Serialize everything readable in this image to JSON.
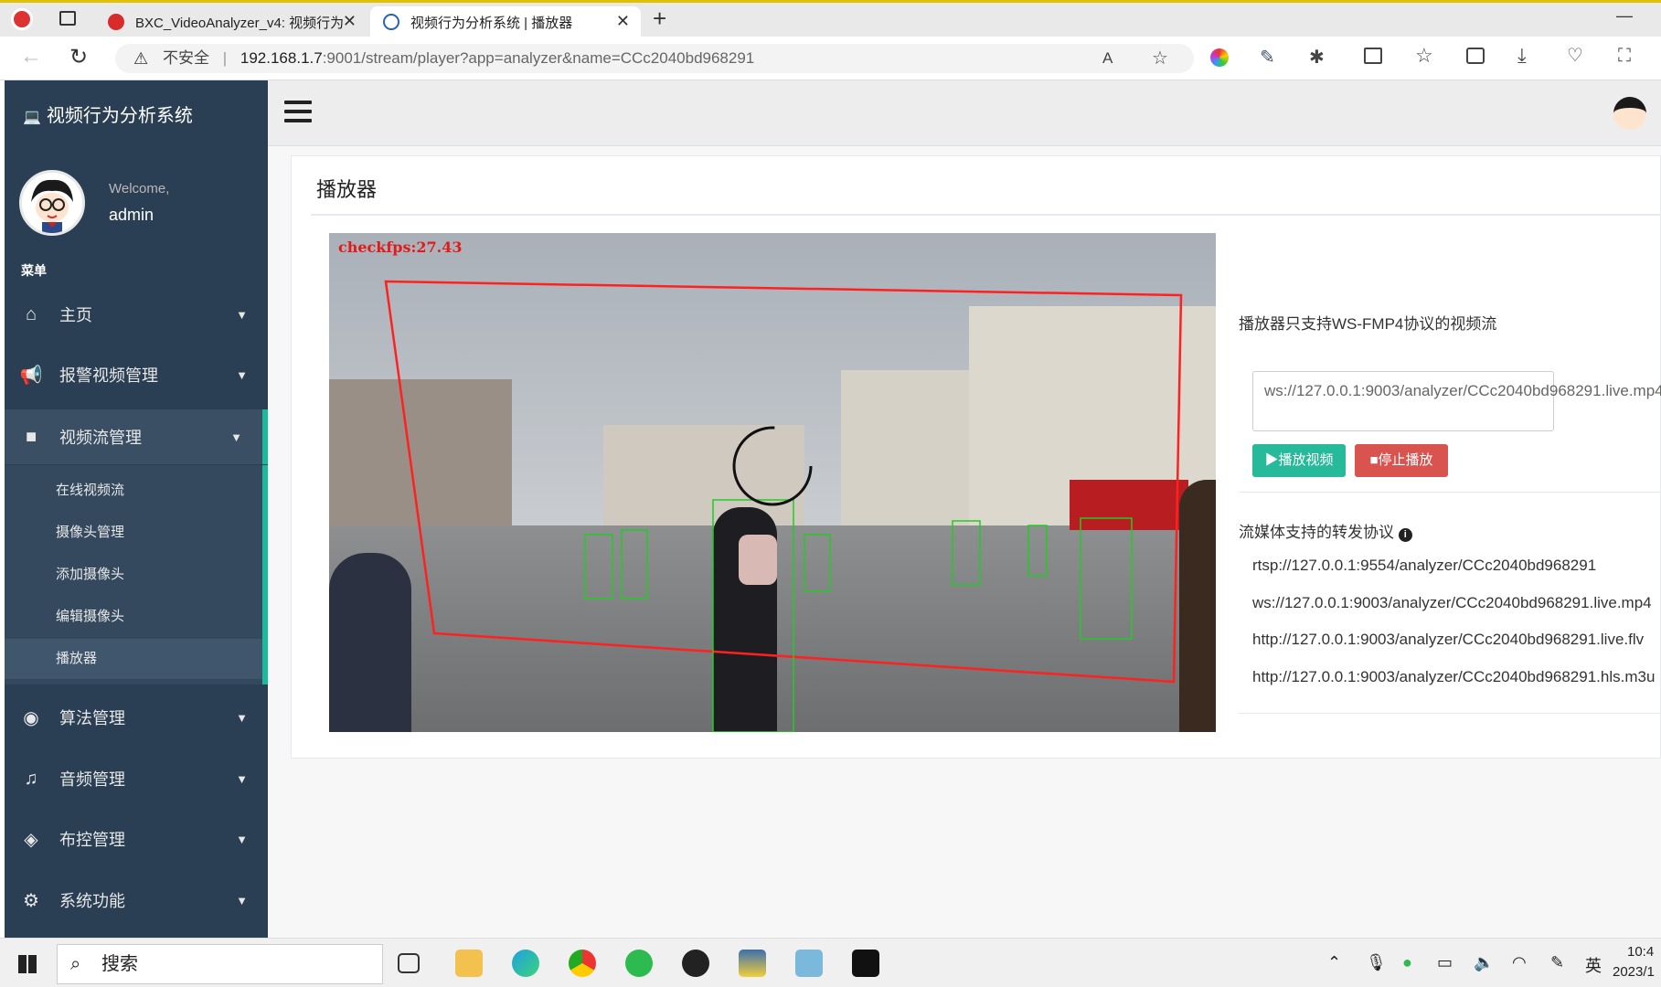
{
  "browser": {
    "tabs": [
      {
        "label": "BXC_VideoAnalyzer_v4: 视频行为",
        "active": false
      },
      {
        "label": "视频行为分析系统 | 播放器",
        "active": true
      }
    ],
    "security": "不安全",
    "url_host": "192.168.1.7",
    "url_rest": ":9001/stream/player?app=analyzer&name=CCc2040bd968291"
  },
  "sidebar": {
    "brand": "视频行为分析系统",
    "welcome": "Welcome,",
    "username": "admin",
    "menu_heading": "菜单",
    "items": [
      {
        "label": "主页",
        "icon": "home-icon"
      },
      {
        "label": "报警视频管理",
        "icon": "bullhorn-icon"
      },
      {
        "label": "视频流管理",
        "icon": "video-camera-icon"
      },
      {
        "label": "算法管理",
        "icon": "eye-icon"
      },
      {
        "label": "音频管理",
        "icon": "music-icon"
      },
      {
        "label": "布控管理",
        "icon": "cube-icon"
      },
      {
        "label": "系统功能",
        "icon": "gear-icon"
      }
    ],
    "subitems": [
      "在线视频流",
      "摄像头管理",
      "添加摄像头",
      "编辑摄像头",
      "播放器"
    ]
  },
  "main": {
    "title": "播放器",
    "video": {
      "fps_text": "checkfps:27.43"
    },
    "notice": "播放器只支持WS-FMP4协议的视频流",
    "ws_url": "ws://127.0.0.1:9003/analyzer/CCc2040bd968291.live.mp4",
    "play_label": "播放视频",
    "stop_label": "停止播放",
    "protocols_heading": "流媒体支持的转发协议",
    "protocols": [
      "rtsp://127.0.0.1:9554/analyzer/CCc2040bd968291",
      "ws://127.0.0.1:9003/analyzer/CCc2040bd968291.live.mp4",
      "http://127.0.0.1:9003/analyzer/CCc2040bd968291.live.flv",
      "http://127.0.0.1:9003/analyzer/CCc2040bd968291.hls.m3u"
    ]
  },
  "taskbar": {
    "search_placeholder": "搜索",
    "ime": "英",
    "clock_time": "10:4",
    "clock_date": "2023/1"
  },
  "colors": {
    "sidebar": "#2a3f54",
    "accent": "#1abb9c",
    "play": "#26b99a",
    "stop": "#d9534f"
  }
}
